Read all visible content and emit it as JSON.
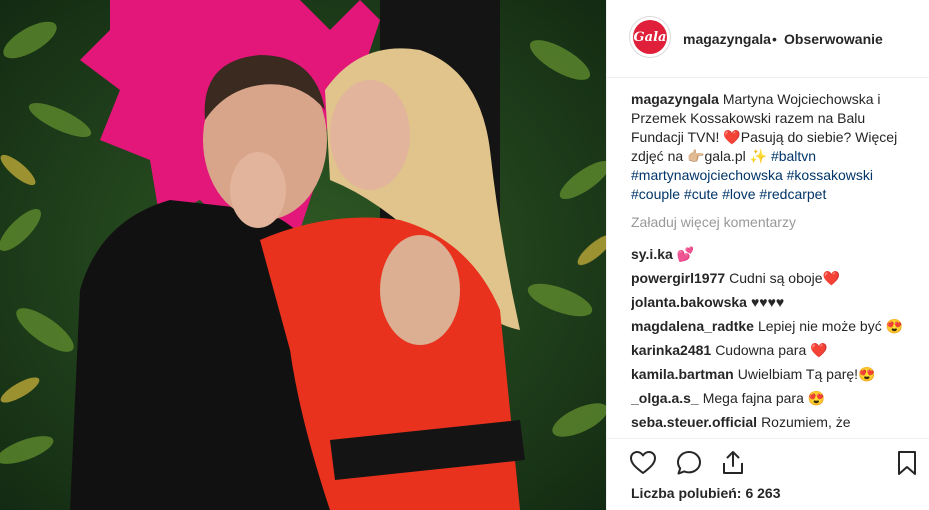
{
  "post": {
    "username": "magazyngala",
    "separator": "•",
    "follow_label": "Obserwowanie",
    "avatar_text": "Gala"
  },
  "caption": {
    "username": "magazyngala",
    "text": "Martyna Wojciechowska i Przemek Kossakowski razem na Balu Fundacji TVN! ❤️Pasują do siebie? Więcej zdjęć na 👉🏼gala.pl ✨",
    "hashtags": "#baltvn #martynawojciechowska #kossakowski #couple #cute #love #redcarpet"
  },
  "load_more_label": "Załaduj więcej komentarzy",
  "comments": [
    {
      "user": "sy.i.ka",
      "text": "💕"
    },
    {
      "user": "powergirl1977",
      "text": "Cudni są oboje❤️"
    },
    {
      "user": "jolanta.bakowska",
      "text": "♥♥♥♥"
    },
    {
      "user": "magdalena_radtke",
      "text": "Lepiej nie może być 😍"
    },
    {
      "user": "karinka2481",
      "text": "Cudowna para ❤️"
    },
    {
      "user": "kamila.bartman",
      "text": "Uwielbiam Tą parę!😍"
    },
    {
      "user": "_olga.a.s_",
      "text": "Mega fajna para 😍"
    },
    {
      "user": "seba.steuer.official",
      "text": "Rozumiem, że"
    }
  ],
  "likes": {
    "label": "Liczba polubień:",
    "count": "6 263"
  },
  "icons": {
    "like": "heart-outline-icon",
    "comment": "speech-bubble-icon",
    "share": "share-upload-icon",
    "save": "bookmark-icon"
  },
  "colors": {
    "brand_red": "#e0203a",
    "hashtag_blue": "#003569",
    "muted_gray": "#999999"
  }
}
